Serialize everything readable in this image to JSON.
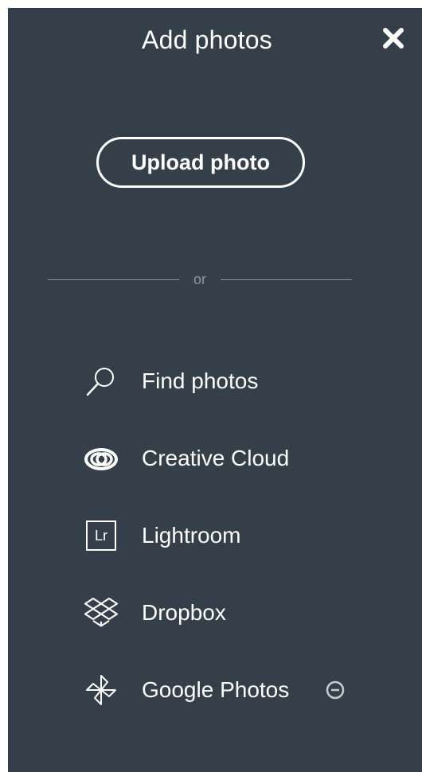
{
  "dialog": {
    "title": "Add photos",
    "close_icon": "close-x-icon"
  },
  "upload": {
    "label": "Upload photo"
  },
  "divider": {
    "text": "or"
  },
  "sources": [
    {
      "label": "Find photos",
      "icon": "search-icon"
    },
    {
      "label": "Creative Cloud",
      "icon": "creative-cloud-icon"
    },
    {
      "label": "Lightroom",
      "icon": "lightroom-icon",
      "icon_text": "Lr"
    },
    {
      "label": "Dropbox",
      "icon": "dropbox-icon"
    },
    {
      "label": "Google Photos",
      "icon": "google-photos-icon",
      "action_icon": "remove-circle-icon"
    }
  ],
  "colors": {
    "panel_background": "#353f49",
    "text": "#ffffff",
    "muted": "#8f98a1"
  }
}
